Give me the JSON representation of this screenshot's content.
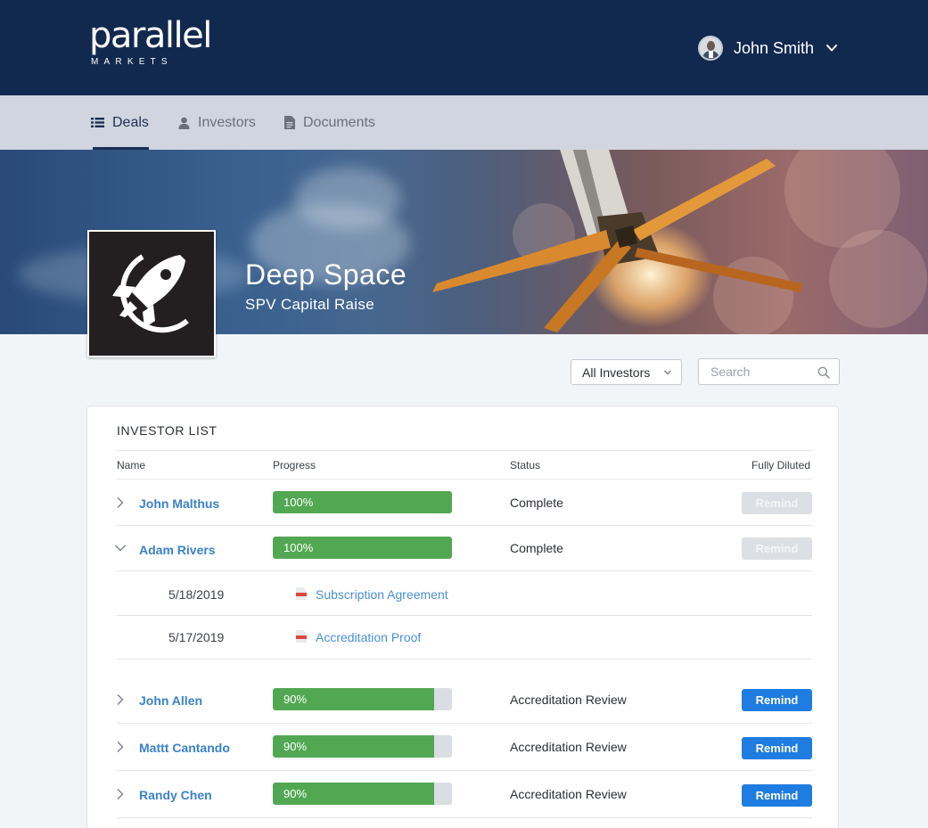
{
  "brand": {
    "name": "parallel",
    "tagline": "MARKETS"
  },
  "user": {
    "name": "John Smith"
  },
  "nav": {
    "tabs": [
      {
        "label": "Deals",
        "icon": "list-icon",
        "active": true
      },
      {
        "label": "Investors",
        "icon": "person-icon",
        "active": false
      },
      {
        "label": "Documents",
        "icon": "document-icon",
        "active": false
      }
    ]
  },
  "deal": {
    "title": "Deep Space",
    "subtitle": "SPV Capital Raise",
    "logo_icon": "rocket-icon"
  },
  "filters": {
    "investor_filter": "All Investors",
    "search_placeholder": "Search"
  },
  "investor_list": {
    "title": "INVESTOR LIST",
    "columns": {
      "name": "Name",
      "progress": "Progress",
      "status": "Status",
      "action": "Fully Diluted"
    },
    "rows": [
      {
        "name": "John Malthus",
        "progress": 100,
        "progress_label": "100%",
        "status": "Complete",
        "action": "Remind",
        "action_enabled": false,
        "expanded": false
      },
      {
        "name": "Adam Rivers",
        "progress": 100,
        "progress_label": "100%",
        "status": "Complete",
        "action": "Remind",
        "action_enabled": false,
        "expanded": true,
        "documents": [
          {
            "date": "5/18/2019",
            "title": "Subscription Agreement"
          },
          {
            "date": "5/17/2019",
            "title": "Accreditation Proof"
          }
        ]
      },
      {
        "name": "John Allen",
        "progress": 90,
        "progress_label": "90%",
        "status": "Accreditation Review",
        "action": "Remind",
        "action_enabled": true,
        "expanded": false
      },
      {
        "name": "Mattt Cantando",
        "progress": 90,
        "progress_label": "90%",
        "status": "Accreditation Review",
        "action": "Remind",
        "action_enabled": true,
        "expanded": false
      },
      {
        "name": "Randy Chen",
        "progress": 90,
        "progress_label": "90%",
        "status": "Accreditation Review",
        "action": "Remind",
        "action_enabled": true,
        "expanded": false
      }
    ]
  },
  "colors": {
    "navbar": "#12294f",
    "subnav": "#d0d5df",
    "progress_fill": "#52a852",
    "primary_button": "#1f7ce0",
    "link": "#3a82c9"
  }
}
